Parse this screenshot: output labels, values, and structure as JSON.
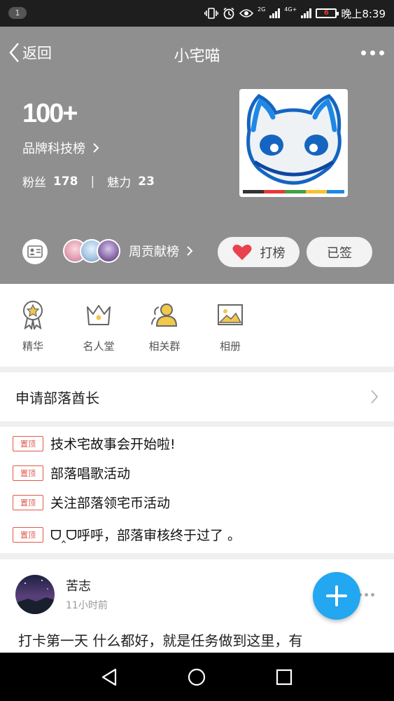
{
  "status_bar": {
    "notification_count": "1",
    "network_2g": "2G",
    "network_4g": "4G+",
    "battery_level": "6",
    "time": "晚上8:39",
    "icons": [
      "vibrate-icon",
      "alarm-icon",
      "eye-icon",
      "signal-icon",
      "battery-icon"
    ]
  },
  "header": {
    "back_label": "返回",
    "title": "小宅喵",
    "rank_number": "100+",
    "rank_link_label": "品牌科技榜",
    "fans_label": "粉丝",
    "fans_count": "178",
    "charm_label": "魅力",
    "charm_count": "23",
    "contrib_label": "周贡献榜",
    "dabang_label": "打榜",
    "signed_label": "已签",
    "colors": {
      "bg": "#8f8f8f",
      "heart": "#e8424f"
    }
  },
  "features": [
    {
      "label": "精华",
      "icon": "medal-icon"
    },
    {
      "label": "名人堂",
      "icon": "crown-icon"
    },
    {
      "label": "相关群",
      "icon": "group-icon"
    },
    {
      "label": "相册",
      "icon": "photo-icon"
    }
  ],
  "apply_label": "申请部落酋长",
  "pinned": {
    "tag": "置顶",
    "items": [
      "技术宅故事会开始啦!",
      "部落唱歌活动",
      "关注部落领宅币活动",
      "ᗜ‸ᗜ呼呼，部落审核终于过了 。"
    ]
  },
  "post": {
    "author": "苦志",
    "time": "11小时前",
    "text": "打卡第一天 什么都好，就是任务做到这里，有"
  },
  "fab_color": "#22a7f0"
}
